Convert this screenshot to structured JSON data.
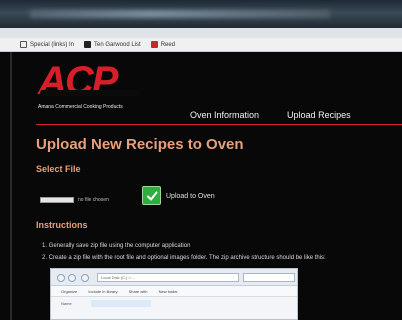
{
  "bookmarks": [
    {
      "label": "Special (links) In",
      "icon": "search-icon"
    },
    {
      "label": "Ten Garwood List",
      "icon": "tse-icon"
    },
    {
      "label": "Reed",
      "icon": "red-icon"
    }
  ],
  "logo": {
    "text": "ACP",
    "subtitle": "Amana Commercial Cooking Products"
  },
  "nav": [
    {
      "label": "Oven Information"
    },
    {
      "label": "Upload Recipes"
    }
  ],
  "page": {
    "title": "Upload New Recipes to Oven",
    "select_file_label": "Select File",
    "file_input_status": "no file chosen",
    "upload_label": "Upload to Oven",
    "instructions_heading": "Instructions",
    "steps": [
      "1. Generally save zip file using the computer application",
      "2. Create a zip file with the root file and optional images folder. The zip archive structure should be like this:"
    ]
  },
  "embedded_screenshot": {
    "address": "Local Disk (C:) > ...",
    "toolbar": [
      "Organize",
      "Include in library",
      "Share with",
      "New folder"
    ],
    "row_label": "Name"
  },
  "colors": {
    "brand_red": "#d61f2b",
    "heading_orange": "#e8a07a",
    "upload_green": "#2fae3f",
    "background": "#080808"
  }
}
